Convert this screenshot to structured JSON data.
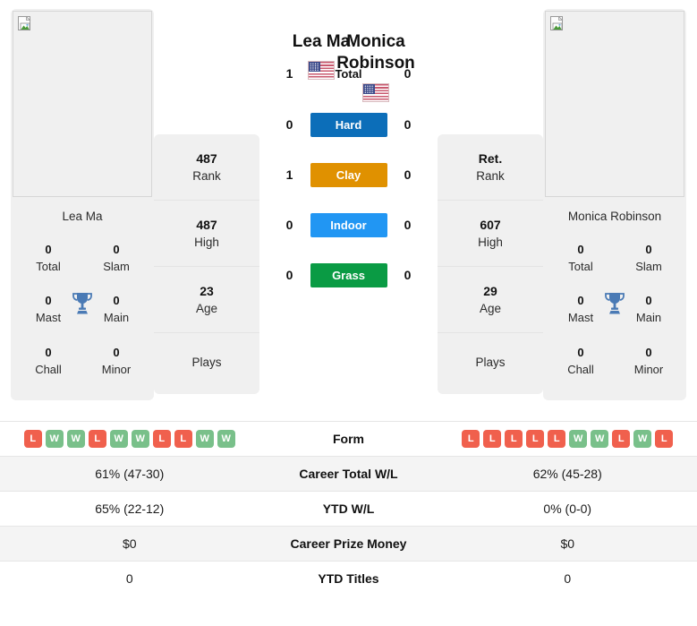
{
  "players": {
    "left": {
      "name": "Lea Ma",
      "panel_name": "Lea Ma",
      "flag": "us-flag-icon",
      "photo": "broken-image-icon",
      "rank": "487",
      "rank_label": "Rank",
      "high": "487",
      "high_label": "High",
      "age": "23",
      "age_label": "Age",
      "plays": "Plays",
      "titles": {
        "total": "0",
        "total_label": "Total",
        "slam": "0",
        "slam_label": "Slam",
        "mast": "0",
        "mast_label": "Mast",
        "main": "0",
        "main_label": "Main",
        "chall": "0",
        "chall_label": "Chall",
        "minor": "0",
        "minor_label": "Minor"
      },
      "form": [
        "L",
        "W",
        "W",
        "L",
        "W",
        "W",
        "L",
        "L",
        "W",
        "W"
      ],
      "career_wl": "61% (47-30)",
      "ytd_wl": "65% (22-12)",
      "prize_money": "$0",
      "ytd_titles": "0"
    },
    "right": {
      "name": "Monica Robinson",
      "name_line1": "Monica",
      "name_line2": "Robinson",
      "panel_name": "Monica Robinson",
      "flag": "us-flag-icon",
      "photo": "broken-image-icon",
      "rank": "Ret.",
      "rank_label": "Rank",
      "high": "607",
      "high_label": "High",
      "age": "29",
      "age_label": "Age",
      "plays": "Plays",
      "titles": {
        "total": "0",
        "total_label": "Total",
        "slam": "0",
        "slam_label": "Slam",
        "mast": "0",
        "mast_label": "Mast",
        "main": "0",
        "main_label": "Main",
        "chall": "0",
        "chall_label": "Chall",
        "minor": "0",
        "minor_label": "Minor"
      },
      "form": [
        "L",
        "L",
        "L",
        "L",
        "L",
        "W",
        "W",
        "L",
        "W",
        "L"
      ],
      "career_wl": "62% (45-28)",
      "ytd_wl": "0% (0-0)",
      "prize_money": "$0",
      "ytd_titles": "0"
    }
  },
  "h2h": [
    {
      "label": "Total",
      "left": "1",
      "right": "0",
      "color": "",
      "colored": false
    },
    {
      "label": "Hard",
      "left": "0",
      "right": "0",
      "color": "#0c6eb9",
      "colored": true
    },
    {
      "label": "Clay",
      "left": "1",
      "right": "0",
      "color": "#e09100",
      "colored": true
    },
    {
      "label": "Indoor",
      "left": "0",
      "right": "0",
      "color": "#2196f3",
      "colored": true
    },
    {
      "label": "Grass",
      "left": "0",
      "right": "0",
      "color": "#0a9b44",
      "colored": true
    }
  ],
  "table_rows": [
    {
      "label": "Form",
      "type": "form",
      "shaded": false
    },
    {
      "label": "Career Total W/L",
      "type": "text",
      "shaded": true,
      "left": "61% (47-30)",
      "right": "62% (45-28)"
    },
    {
      "label": "YTD W/L",
      "type": "text",
      "shaded": false,
      "left": "65% (22-12)",
      "right": "0% (0-0)"
    },
    {
      "label": "Career Prize Money",
      "type": "text",
      "shaded": true,
      "left": "$0",
      "right": "$0"
    },
    {
      "label": "YTD Titles",
      "type": "text",
      "shaded": false,
      "left": "0",
      "right": "0"
    }
  ],
  "colors": {
    "hard": "#0c6eb9",
    "clay": "#e09100",
    "indoor": "#2196f3",
    "grass": "#0a9b44",
    "win": "#79c08a",
    "loss": "#f0604d",
    "trophy": "#4a7ab5",
    "panel_bg": "#f0f0f0"
  }
}
